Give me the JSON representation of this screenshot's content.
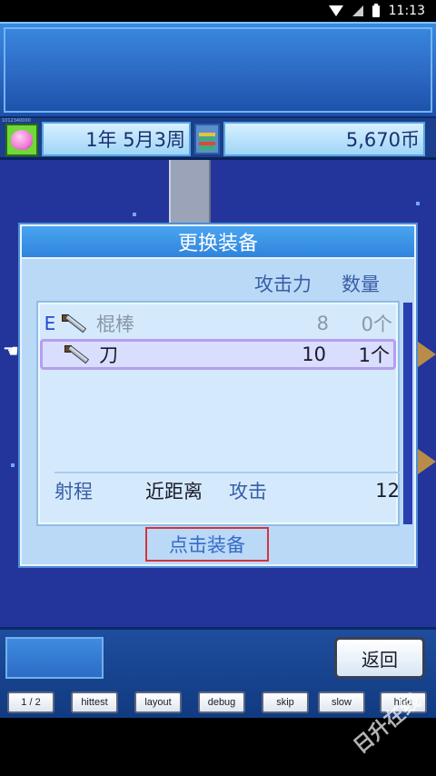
{
  "status_bar": {
    "time": "11:13",
    "icons": [
      "wifi-icon",
      "signal-icon",
      "battery-icon"
    ]
  },
  "header": {
    "tiny_code": "1012340000",
    "date": "1年 5月3周",
    "money": "5,670币"
  },
  "dialog": {
    "title": "更换装备",
    "columns": {
      "attack": "攻击力",
      "quantity": "数量"
    },
    "items": [
      {
        "equipped_mark": "E",
        "icon": "stick-icon",
        "name": "棍棒",
        "attack": "8",
        "quantity": "0个",
        "selected": false
      },
      {
        "equipped_mark": "",
        "icon": "sword-icon",
        "name": "刀",
        "attack": "10",
        "quantity": "1个",
        "selected": true
      }
    ],
    "stats": {
      "range_label": "射程",
      "range_value": "近距离",
      "attack_label": "攻击",
      "attack_value": "12"
    },
    "equip_button": "点击装备"
  },
  "bottom": {
    "back_button": "返回",
    "debug_buttons": [
      "1 / 2",
      "hittest",
      "layout",
      "debug",
      "skip",
      "slow",
      "hide"
    ]
  },
  "watermark": "日升在线",
  "colors": {
    "dialog_bg": "#b9d9f7",
    "title_bar": "#2f84dc",
    "highlight_border": "#d8323c",
    "field_bg": "#23359a"
  }
}
